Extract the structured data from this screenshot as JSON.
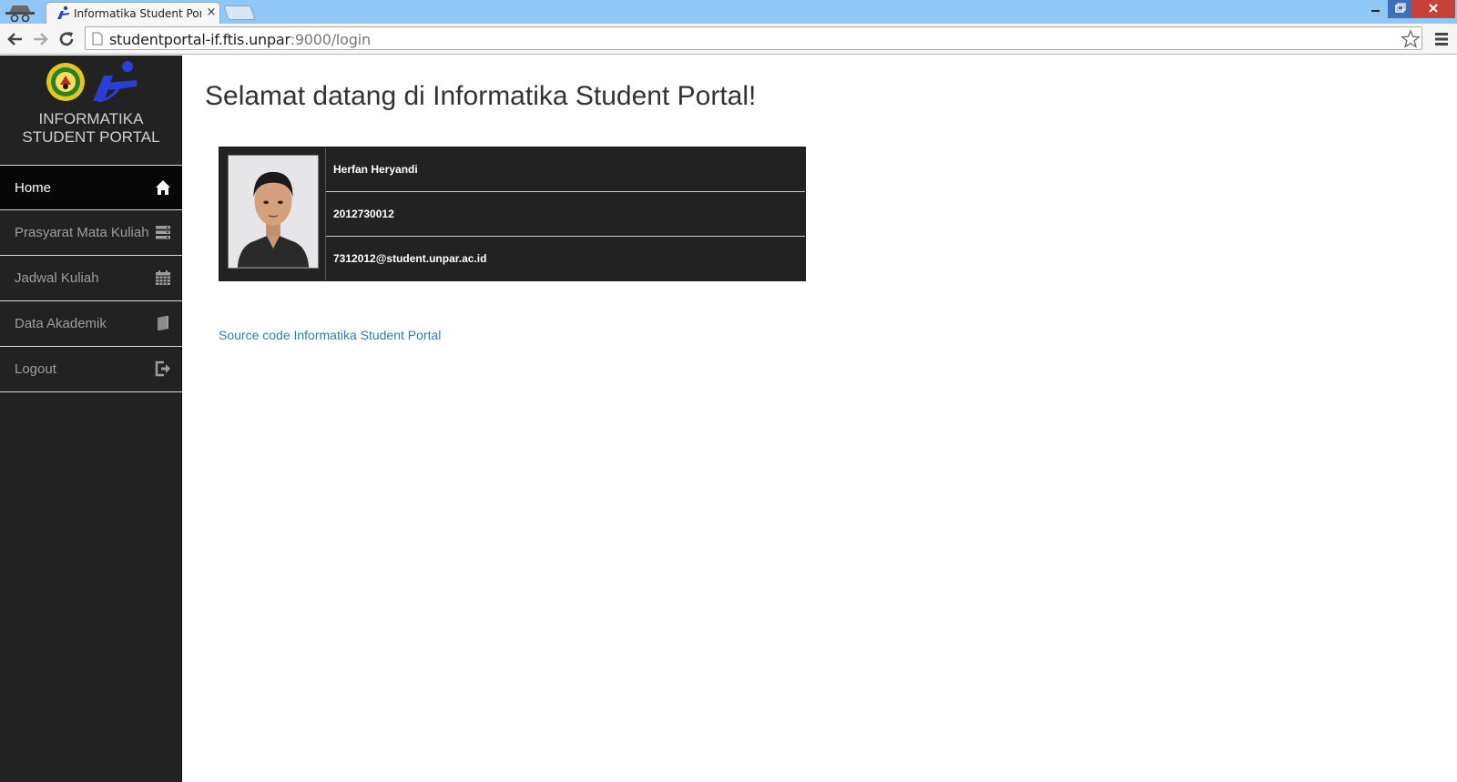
{
  "browser": {
    "tab_title": "Informatika Student Portal",
    "tab_close": "×",
    "url_host": "studentportal-if.ftis.unpar",
    "url_rest": ":9000/login"
  },
  "sidebar": {
    "brand_line1": "INFORMATIKA",
    "brand_line2": "STUDENT PORTAL",
    "items": [
      {
        "label": "Home",
        "icon": "home-icon",
        "active": true
      },
      {
        "label": "Prasyarat Mata Kuliah",
        "icon": "list-icon",
        "active": false
      },
      {
        "label": "Jadwal Kuliah",
        "icon": "calendar-icon",
        "active": false
      },
      {
        "label": "Data Akademik",
        "icon": "book-icon",
        "active": false
      },
      {
        "label": "Logout",
        "icon": "logout-icon",
        "active": false
      }
    ]
  },
  "main": {
    "title": "Selamat datang di Informatika Student Portal!",
    "student": {
      "name": "Herfan Heryandi",
      "npm": "2012730012",
      "email": "7312012@student.unpar.ac.id"
    },
    "source_link": "Source code Informatika Student Portal"
  },
  "colors": {
    "sidebar_bg": "#222222",
    "active_bg": "#080808",
    "link": "#337ab7",
    "titlebar": "#8fc7f7"
  }
}
